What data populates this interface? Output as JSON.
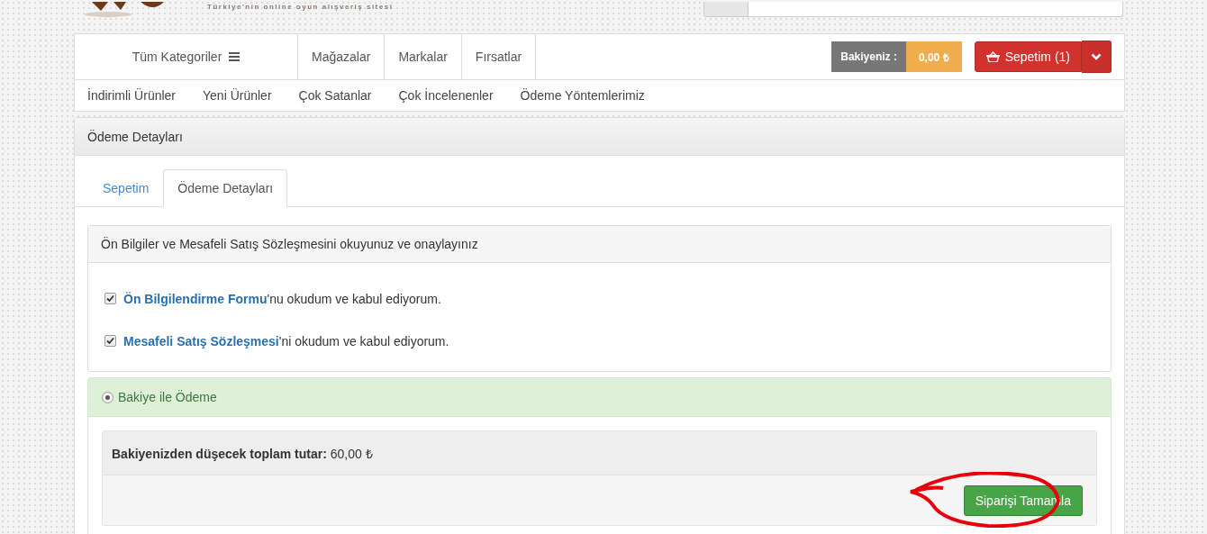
{
  "header": {
    "tagline": "Türkiye'nin online oyun alışveriş sitesi"
  },
  "main_nav": {
    "categories": "Tüm Kategoriler",
    "links": [
      "Mağazalar",
      "Markalar",
      "Fırsatlar"
    ],
    "balance_label": "Bakiyeniz :",
    "balance_value": "0,00 ₺",
    "cart": "Sepetim (1)"
  },
  "sub_nav": [
    "İndirimli Ürünler",
    "Yeni Ürünler",
    "Çok Satanlar",
    "Çok İncelenenler",
    "Ödeme Yöntemlerimiz"
  ],
  "panel": {
    "title": "Ödeme Detayları",
    "tabs": [
      {
        "label": "Sepetim",
        "selected": false
      },
      {
        "label": "Ödeme Detayları",
        "selected": true
      }
    ],
    "agreements": {
      "title": "Ön Bilgiler ve Mesafeli Satış Sözleşmesini okuyunuz ve onaylayınız",
      "items": [
        {
          "link": "Ön Bilgilendirme Formu",
          "text": "'nu okudum ve kabul ediyorum.",
          "checked": true
        },
        {
          "link": "Mesafeli Satış Sözleşmesi",
          "text": "'ni okudum ve kabul ediyorum.",
          "checked": true
        }
      ]
    },
    "payment": {
      "option": "Bakiye ile Ödeme",
      "selected": true,
      "total_label": "Bakiyenizden düşecek toplam tutar:",
      "total_value": "60,00 ₺",
      "button": "Siparişi Tamamla"
    }
  }
}
